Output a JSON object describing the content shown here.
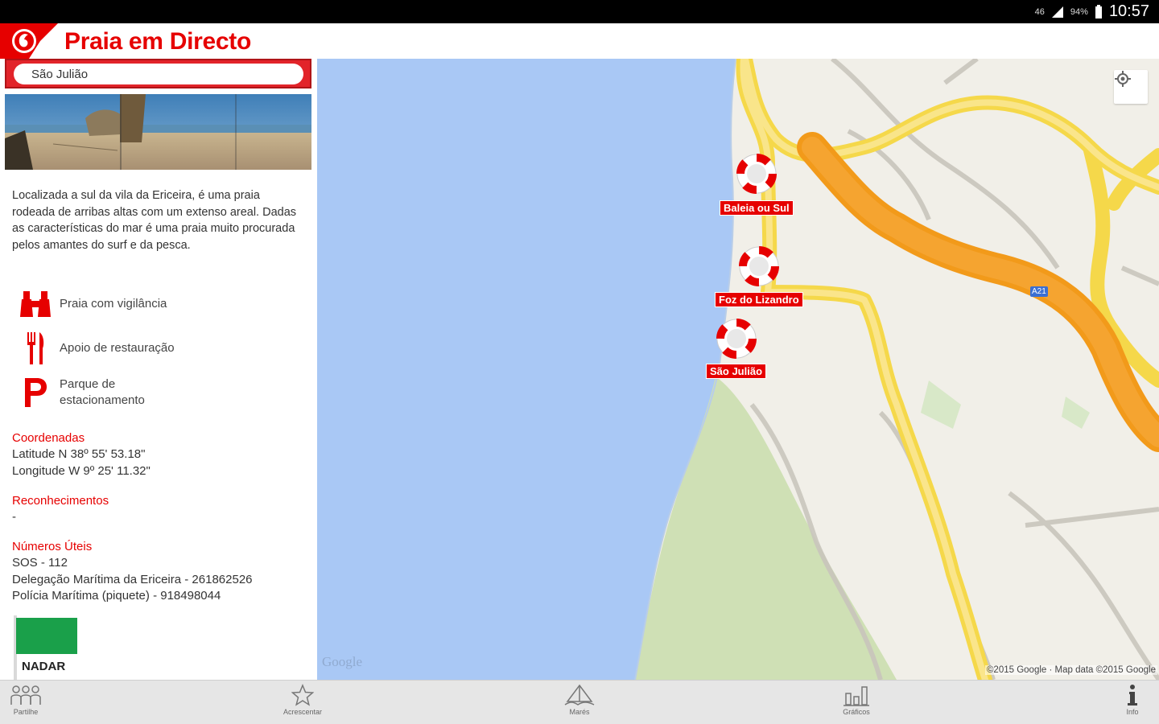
{
  "status_bar": {
    "left_small_1": "46",
    "battery_percent": "94%",
    "time": "10:57"
  },
  "app": {
    "title": "Praia em Directo",
    "brand_color": "#e60000"
  },
  "search": {
    "value": "São Julião"
  },
  "beach": {
    "description": "Localizada a sul da vila da Ericeira, é uma praia rodeada de arribas altas com um extenso areal. Dadas as características do mar é uma praia muito procurada pelos amantes do surf e da pesca.",
    "features": [
      {
        "icon": "binoculars-icon",
        "label": "Praia com vigilância"
      },
      {
        "icon": "fork-knife-icon",
        "label": "Apoio de restauração"
      },
      {
        "icon": "parking-icon",
        "label": "Parque de estacionamento"
      }
    ],
    "coordinates": {
      "title": "Coordenadas",
      "latitude": "Latitude N 38º 55' 53.18\"",
      "longitude": "Longitude W 9º 25' 11.32\""
    },
    "recognitions": {
      "title": "Reconhecimentos",
      "value": "-"
    },
    "useful_numbers": {
      "title": "Números Úteis",
      "lines": [
        "SOS - 112",
        "Delegação Marítima da Ericeira - 261862526",
        "Polícia Marítima (piquete) - 918498044"
      ]
    },
    "flag": {
      "color": "#1aa04a",
      "label": "NADAR"
    }
  },
  "map": {
    "markers": [
      {
        "label": "Baleia ou Sul"
      },
      {
        "label": "Foz do Lizandro"
      },
      {
        "label": "São Julião"
      }
    ],
    "road_label": "A21",
    "google_logo": "Google",
    "attribution": "©2015 Google · Map data ©2015 Google"
  },
  "bottom_nav": [
    {
      "label": "Partilhe",
      "icon": "people-icon"
    },
    {
      "label": "Acrescentar",
      "icon": "star-icon"
    },
    {
      "label": "Marés",
      "icon": "tide-icon"
    },
    {
      "label": "Gráficos",
      "icon": "bar-chart-icon"
    },
    {
      "label": "Info",
      "icon": "info-icon"
    }
  ]
}
